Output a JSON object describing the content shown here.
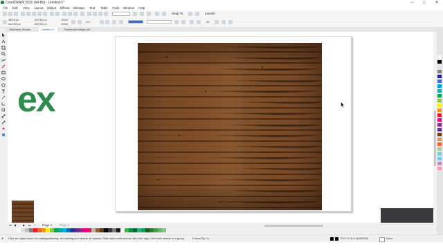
{
  "window": {
    "title": "CorelDRAW 2020 (64-Bit) - Untitled-1*",
    "controls": [
      "–",
      "□",
      "✕"
    ]
  },
  "menu": [
    "File",
    "Edit",
    "View",
    "Layout",
    "Object",
    "Effects",
    "Bitmaps",
    "Text",
    "Table",
    "Tools",
    "Window",
    "Help"
  ],
  "toolbar": {
    "zoom_value": "",
    "snap_to_label": "Snap To",
    "launch_label": "Launch"
  },
  "property_bar": {
    "x_value": "480.8 px",
    "y_value": "424.09 px",
    "width_value": "410.62 px",
    "height_value": "349.02 px",
    "scale_x": "103.8",
    "scale_y": "103.8",
    "rotation_value": "0.0",
    "outline_value": "",
    "number_field": "30"
  },
  "tabs": [
    {
      "label": "Welcome Screen",
      "active": false
    },
    {
      "label": "Untitled-1*",
      "active": true
    },
    {
      "label": "Thumbnail-cottga.cdr*",
      "active": false
    }
  ],
  "canvas": {
    "partial_text": "ex",
    "text_color": "#2f8a4e"
  },
  "page_nav": {
    "page1": "Page 1",
    "page2": "Page 2"
  },
  "status": {
    "hint": "Click an object twice for rotating/skewing; dbl-clicking tool selects all objects; Shift+click multi-selects; Alt+click digs; Ctrl+click selects in a group",
    "object_type": "PowerClip Cu",
    "fill_info": "R:0 G:0 B:0 (#000000)",
    "outline_info": "None"
  },
  "palette_colors": [
    "#ffffff",
    "#000000",
    "#e6e6e6",
    "#808080",
    "#1f1f8f",
    "#3b6fd6",
    "#00a0e0",
    "#00b7b7",
    "#00a651",
    "#8cc63f",
    "#fff200",
    "#f7941d",
    "#ed1c24",
    "#ec008c",
    "#92278f",
    "#662d91",
    "#603913",
    "#c69c6d",
    "#f26522",
    "#a3d39c",
    "#7accc8",
    "#6dcff6",
    "#bd8cbf",
    "#f49ac2"
  ],
  "bottom_swatches": [
    "#ffffff",
    "#e0e0e0",
    "#c0c0c0",
    "#808080",
    "#ed1c24",
    "#f26522",
    "#f7941d",
    "#fff200",
    "#8cc63f",
    "#00a651",
    "#00a99d",
    "#00aeef",
    "#0072bc",
    "#2e3192",
    "#662d91",
    "#92278f",
    "#ec008c",
    "#ed145b",
    "#c2b59b",
    "#8c6239",
    "#603913",
    "#000000",
    "#363636",
    "#7d7d7d",
    "#1a1a1a",
    "#ffffff",
    "#39b54a",
    "#009245",
    "#006837",
    "#22b573",
    "#00a651",
    "#1b5e20",
    "#2e7d32",
    "#43a047",
    "#66bb6a",
    "#81c784"
  ]
}
